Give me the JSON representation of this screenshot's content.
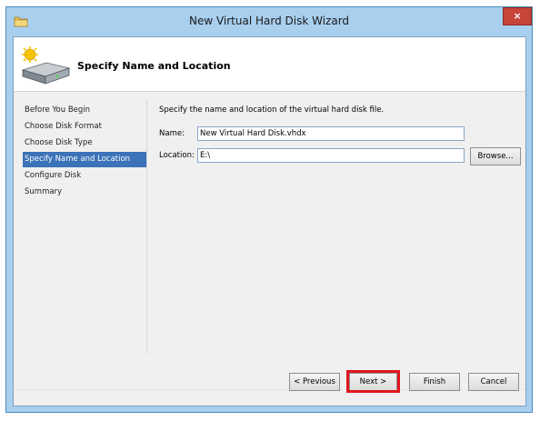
{
  "window": {
    "title": "New Virtual Hard Disk Wizard",
    "close_label": "×",
    "app_icon": "folder-icon"
  },
  "header": {
    "icon": "hard-disk-icon",
    "title": "Specify Name and Location"
  },
  "nav": {
    "items": [
      {
        "label": "Before You Begin",
        "active": false
      },
      {
        "label": "Choose Disk Format",
        "active": false
      },
      {
        "label": "Choose Disk Type",
        "active": false
      },
      {
        "label": "Specify Name and Location",
        "active": true
      },
      {
        "label": "Configure Disk",
        "active": false
      },
      {
        "label": "Summary",
        "active": false
      }
    ]
  },
  "main": {
    "description": "Specify the name and location of the virtual hard disk file.",
    "name_label": "Name:",
    "name_value": "New Virtual Hard Disk.vhdx",
    "location_label": "Location:",
    "location_value": "E:\\",
    "browse_label": "Browse..."
  },
  "footer": {
    "previous_label": "< Previous",
    "next_label": "Next >",
    "finish_label": "Finish",
    "cancel_label": "Cancel"
  },
  "colors": {
    "frame": "#a9cfee",
    "active_nav": "#3b72b8",
    "highlight": "#e0171d",
    "close_button": "#c7443a"
  }
}
